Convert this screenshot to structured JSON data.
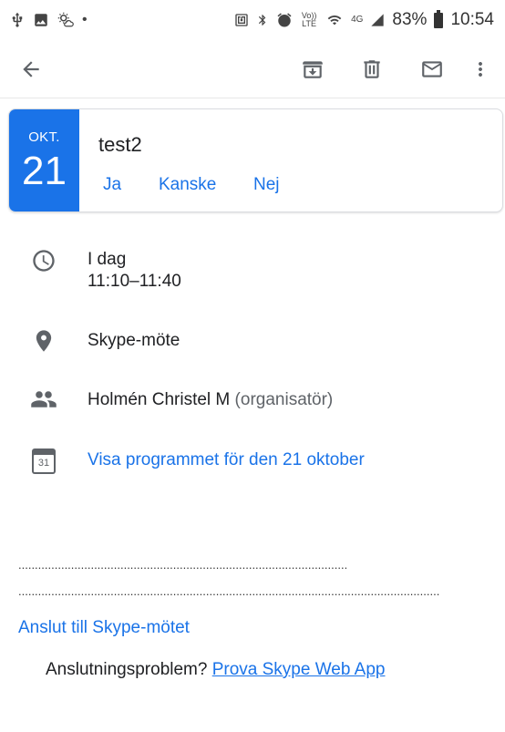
{
  "status_bar": {
    "battery_percent": "83%",
    "time": "10:54",
    "left_icons": [
      "usb-icon",
      "image-icon",
      "weather-icon",
      "dot-icon"
    ],
    "right_icons": [
      "nfc-icon",
      "bluetooth-icon",
      "alarm-icon",
      "volte-icon",
      "wifi-icon",
      "4g-icon",
      "signal-icon",
      "battery-icon"
    ],
    "volte_label": "Vo)) LTE",
    "network_label": "4G"
  },
  "toolbar": {
    "icons": [
      "back-arrow-icon",
      "archive-icon",
      "trash-icon",
      "mail-icon",
      "more-vert-icon"
    ]
  },
  "event": {
    "month": "OKT.",
    "day": "21",
    "title": "test2",
    "rsvp": {
      "yes": "Ja",
      "maybe": "Kanske",
      "no": "Nej"
    },
    "accent_color": "#1a73e8"
  },
  "details": {
    "time_line1": "I dag",
    "time_line2": "11:10–11:40",
    "location": "Skype-möte",
    "organizer_name": "Holmén Christel M",
    "organizer_role": "(organisatör)",
    "calendar_day": "31",
    "calendar_link": "Visa programmet för den 21 oktober"
  },
  "body": {
    "dots1": "......................................................................................................................................",
    "dots2": "....................................................................................................................................................................................",
    "join_link": "Anslut till Skype-mötet",
    "problem_text": "Anslutningsproblem? ",
    "problem_link": "Prova Skype Web App"
  }
}
